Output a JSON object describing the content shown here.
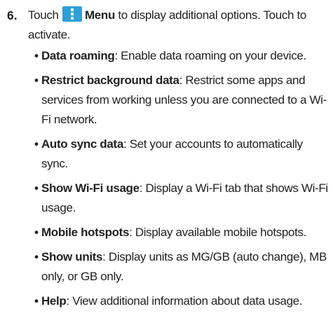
{
  "step": {
    "number": "6.",
    "before_icon": "Touch",
    "menu_icon": "menu-icon",
    "menu_label": "Menu",
    "after_menu": " to display additional options. Touch to activate.",
    "icon_color": "#2f9fd8"
  },
  "options": [
    {
      "term": "Data roaming",
      "desc": ": Enable data roaming on your device."
    },
    {
      "term": "Restrict background data",
      "desc": ": Restrict some apps and services from working unless you are connected to a Wi-Fi network."
    },
    {
      "term": "Auto sync data",
      "desc": ": Set your accounts to automatically sync."
    },
    {
      "term": "Show Wi-Fi usage",
      "desc": ": Display a Wi-Fi tab that shows Wi-Fi usage."
    },
    {
      "term": "Mobile hotspots",
      "desc": ": Display available mobile hotspots."
    },
    {
      "term": "Show units",
      "desc": ": Display units as MG/GB (auto change), MB only, or GB only."
    },
    {
      "term": "Help",
      "desc": ": View additional information about data usage."
    }
  ]
}
